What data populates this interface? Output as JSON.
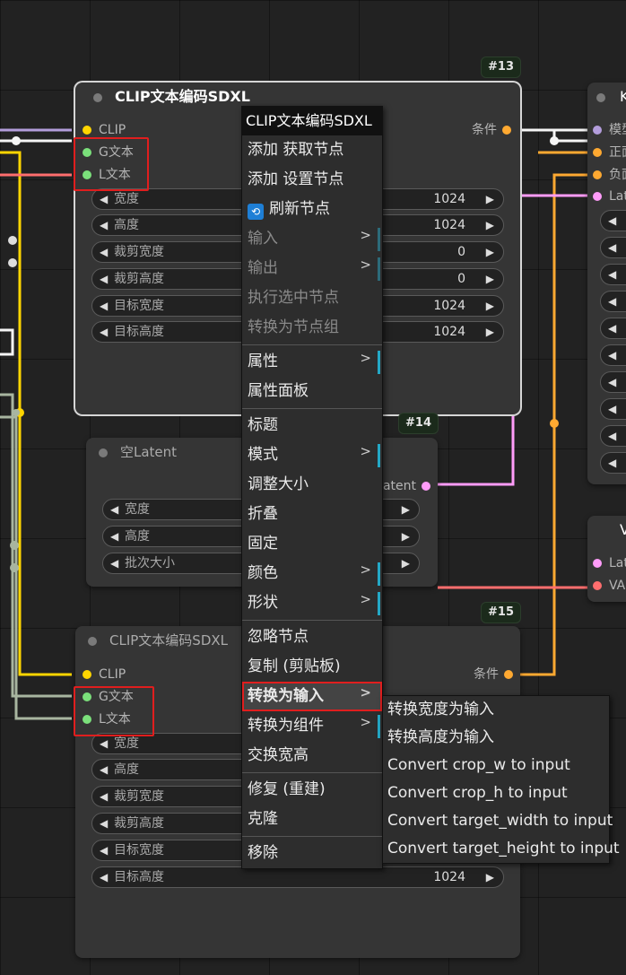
{
  "nodes": {
    "clip13": {
      "badge": "#13",
      "title": "CLIP文本编码SDXL",
      "inputs": [
        "CLIP",
        "G文本",
        "L文本"
      ],
      "output": "条件",
      "widgets": [
        {
          "label": "宽度",
          "value": "1024"
        },
        {
          "label": "高度",
          "value": "1024"
        },
        {
          "label": "裁剪宽度",
          "value": "0"
        },
        {
          "label": "裁剪高度",
          "value": "0"
        },
        {
          "label": "目标宽度",
          "value": "1024"
        },
        {
          "label": "目标高度",
          "value": "1024"
        }
      ]
    },
    "latent14": {
      "badge": "#14",
      "title": "空Latent",
      "output": "Latent",
      "widgets": [
        {
          "label": "宽度"
        },
        {
          "label": "高度"
        },
        {
          "label": "批次大小"
        }
      ]
    },
    "clip15": {
      "badge": "#15",
      "title": "CLIP文本编码SDXL",
      "inputs": [
        "CLIP",
        "G文本",
        "L文本"
      ],
      "output": "条件",
      "widgets": [
        {
          "label": "宽度"
        },
        {
          "label": "高度"
        },
        {
          "label": "裁剪宽度"
        },
        {
          "label": "裁剪高度"
        },
        {
          "label": "目标宽度"
        },
        {
          "label": "目标高度",
          "value": "1024"
        }
      ]
    },
    "right_top": {
      "title": "K",
      "inputs": [
        "模型",
        "正面",
        "负面",
        "Latent"
      ]
    },
    "right_bottom": {
      "title": "V",
      "inputs": [
        "Latent",
        "VAE"
      ]
    }
  },
  "context_menu": {
    "title": "CLIP文本编码SDXL",
    "items": [
      {
        "label": "添加 获取节点"
      },
      {
        "label": "添加 设置节点"
      },
      {
        "label": "刷新节点",
        "icon": "refresh-icon"
      },
      {
        "label": "输入",
        "disabled": true,
        "submenu": true
      },
      {
        "label": "输出",
        "disabled": true,
        "submenu": true
      },
      {
        "label": "执行选中节点",
        "disabled": true
      },
      {
        "label": "转换为节点组",
        "disabled": true
      },
      {
        "separator": true
      },
      {
        "label": "属性",
        "submenu": true
      },
      {
        "label": "属性面板"
      },
      {
        "separator": true
      },
      {
        "label": "标题"
      },
      {
        "label": "模式",
        "submenu": true
      },
      {
        "label": "调整大小"
      },
      {
        "label": "折叠"
      },
      {
        "label": "固定"
      },
      {
        "label": "颜色",
        "submenu": true
      },
      {
        "label": "形状",
        "submenu": true
      },
      {
        "separator": true
      },
      {
        "label": "忽略节点"
      },
      {
        "label": "复制 (剪贴板)"
      },
      {
        "label": "转换为输入",
        "submenu": true,
        "highlighted": true
      },
      {
        "label": "转换为组件",
        "submenu": true
      },
      {
        "label": "交换宽高"
      },
      {
        "separator": true
      },
      {
        "label": "修复 (重建)"
      },
      {
        "label": "克隆"
      },
      {
        "separator": true
      },
      {
        "label": "移除"
      }
    ],
    "submenu_arrow": ">"
  },
  "submenu": {
    "items": [
      "转换宽度为输入",
      "转换高度为输入",
      "Convert crop_w to input",
      "Convert crop_h to input",
      "Convert target_width to input",
      "Convert target_height to input"
    ]
  },
  "colors": {
    "clip_wire": "#ffd500",
    "text_wire": "#f5f5f5",
    "cond_wire": "#ffa931",
    "latent_wire": "#ff9cf9",
    "vae_wire": "#ff6e6e",
    "model_wire": "#b39ddb",
    "highlight": "#e01e1e",
    "accent": "#24a8c6"
  }
}
